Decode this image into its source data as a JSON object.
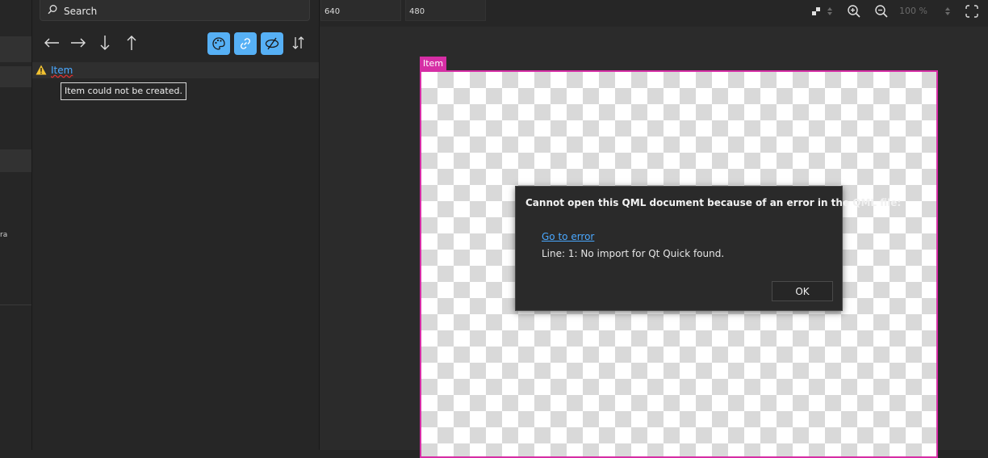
{
  "search": {
    "placeholder": "Search"
  },
  "navigator": {
    "tree_item_label": "Item",
    "tooltip": "Item could not be created."
  },
  "left_strip": {
    "fragment": "ra"
  },
  "top_bar": {
    "width_value": "640",
    "height_value": "480",
    "zoom_level": "100 %"
  },
  "canvas": {
    "item_tag": "Item"
  },
  "dialog": {
    "title": "Cannot open this QML document because of an error in the QML file:",
    "link": "Go to error",
    "message": "Line: 1: No import for Qt Quick found.",
    "ok_label": "OK"
  },
  "colors": {
    "accent": "#56b0f5",
    "selection": "#d62ea5",
    "link": "#4aa8ff",
    "warning": "#f2c232"
  },
  "icons": [
    "search-icon",
    "arrow-left-icon",
    "arrow-right-icon",
    "arrow-down-icon",
    "arrow-up-icon",
    "palette-icon",
    "link-icon",
    "visibility-off-icon",
    "sort-icon",
    "warning-icon",
    "background-color-icon",
    "zoom-in-icon",
    "zoom-out-icon",
    "fit-to-screen-icon"
  ]
}
